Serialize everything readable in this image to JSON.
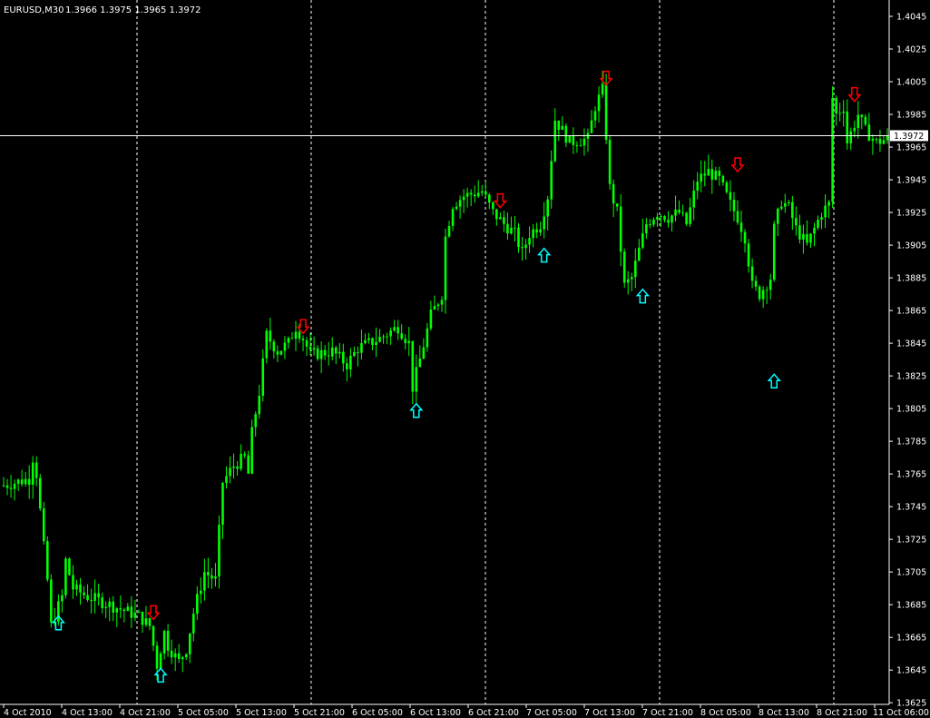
{
  "header": {
    "symbol_text": "EURUSD,M30",
    "ohlc_text": "1.3966 1.3975 1.3965 1.3972"
  },
  "colors": {
    "background": "#000000",
    "candles": "#00FF00",
    "axis": "#FFFFFF",
    "grid": "#FFFFFF",
    "up_arrow": "#00FFFF",
    "down_arrow": "#FF0000",
    "price_line": "#FFFFFF"
  },
  "chart_data": {
    "type": "candlestick",
    "title": "EURUSD,M30",
    "grid": "vertical dashed at day boundaries",
    "ylim": [
      1.3624,
      1.4055
    ],
    "y_ticks": [
      "1.4045",
      "1.4025",
      "1.4005",
      "1.3985",
      "1.3965",
      "1.3945",
      "1.3925",
      "1.3905",
      "1.3885",
      "1.3865",
      "1.3845",
      "1.3825",
      "1.3805",
      "1.3785",
      "1.3765",
      "1.3745",
      "1.3725",
      "1.3705",
      "1.3685",
      "1.3665",
      "1.3645",
      "1.3625"
    ],
    "x_ticks": [
      "4 Oct 2010",
      "4 Oct 13:00",
      "4 Oct 21:00",
      "5 Oct 05:00",
      "5 Oct 13:00",
      "5 Oct 21:00",
      "6 Oct 05:00",
      "6 Oct 13:00",
      "6 Oct 21:00",
      "7 Oct 05:00",
      "7 Oct 13:00",
      "7 Oct 21:00",
      "8 Oct 05:00",
      "8 Oct 13:00",
      "8 Oct 21:00",
      "11 Oct 06:00"
    ],
    "day_separators": [
      "4 Oct 21:00",
      "5 Oct 21:00",
      "6 Oct 21:00",
      "7 Oct 21:00",
      "8 Oct 21:00"
    ],
    "current_price": "1.3972",
    "price_anchors": [
      [
        0,
        1.3758
      ],
      [
        7,
        1.3762
      ],
      [
        8,
        1.3775
      ],
      [
        9,
        1.3765
      ],
      [
        11,
        1.372
      ],
      [
        12,
        1.37
      ],
      [
        13,
        1.3672
      ],
      [
        16,
        1.369
      ],
      [
        17,
        1.3712
      ],
      [
        19,
        1.3695
      ],
      [
        23,
        1.369
      ],
      [
        29,
        1.3685
      ],
      [
        37,
        1.3678
      ],
      [
        40,
        1.3672
      ],
      [
        42,
        1.3648
      ],
      [
        44,
        1.3668
      ],
      [
        45,
        1.366
      ],
      [
        48,
        1.365
      ],
      [
        50,
        1.3658
      ],
      [
        52,
        1.368
      ],
      [
        55,
        1.3705
      ],
      [
        58,
        1.37
      ],
      [
        60,
        1.376
      ],
      [
        63,
        1.377
      ],
      [
        66,
        1.3775
      ],
      [
        67,
        1.3765
      ],
      [
        68,
        1.379
      ],
      [
        70,
        1.3815
      ],
      [
        72,
        1.385
      ],
      [
        75,
        1.384
      ],
      [
        78,
        1.3845
      ],
      [
        80,
        1.3855
      ],
      [
        82,
        1.3848
      ],
      [
        84,
        1.3838
      ],
      [
        90,
        1.384
      ],
      [
        94,
        1.3832
      ],
      [
        97,
        1.3842
      ],
      [
        103,
        1.3848
      ],
      [
        108,
        1.3855
      ],
      [
        111,
        1.3845
      ],
      [
        112,
        1.3818
      ],
      [
        114,
        1.3835
      ],
      [
        117,
        1.3862
      ],
      [
        120,
        1.3875
      ],
      [
        121,
        1.391
      ],
      [
        123,
        1.393
      ],
      [
        126,
        1.3935
      ],
      [
        131,
        1.3938
      ],
      [
        134,
        1.3925
      ],
      [
        137,
        1.3918
      ],
      [
        140,
        1.3912
      ],
      [
        142,
        1.39
      ],
      [
        144,
        1.3912
      ],
      [
        147,
        1.3918
      ],
      [
        149,
        1.3935
      ],
      [
        151,
        1.3982
      ],
      [
        155,
        1.3968
      ],
      [
        160,
        1.397
      ],
      [
        162,
        1.399
      ],
      [
        164,
        1.4
      ],
      [
        165,
        1.3972
      ],
      [
        166,
        1.394
      ],
      [
        168,
        1.3925
      ],
      [
        170,
        1.388
      ],
      [
        172,
        1.3885
      ],
      [
        174,
        1.3902
      ],
      [
        176,
        1.3918
      ],
      [
        179,
        1.3925
      ],
      [
        182,
        1.3922
      ],
      [
        185,
        1.3925
      ],
      [
        187,
        1.3918
      ],
      [
        190,
        1.3945
      ],
      [
        193,
        1.395
      ],
      [
        196,
        1.3945
      ],
      [
        199,
        1.393
      ],
      [
        201,
        1.3922
      ],
      [
        203,
        1.391
      ],
      [
        205,
        1.388
      ],
      [
        207,
        1.3875
      ],
      [
        210,
        1.3885
      ],
      [
        211,
        1.3915
      ],
      [
        213,
        1.3932
      ],
      [
        215,
        1.3928
      ],
      [
        217,
        1.3915
      ],
      [
        220,
        1.3905
      ],
      [
        224,
        1.3925
      ],
      [
        226,
        1.393
      ],
      [
        227,
        1.3995
      ],
      [
        228,
        1.3985
      ],
      [
        230,
        1.399
      ],
      [
        231,
        1.3968
      ],
      [
        234,
        1.3985
      ],
      [
        236,
        1.3975
      ],
      [
        239,
        1.3968
      ],
      [
        242,
        1.397
      ]
    ],
    "signals": [
      {
        "type": "buy",
        "bar": 15,
        "price": 1.3678
      },
      {
        "type": "sell",
        "bar": 41,
        "price": 1.3676
      },
      {
        "type": "buy",
        "bar": 43,
        "price": 1.3646
      },
      {
        "type": "sell",
        "bar": 82,
        "price": 1.3851
      },
      {
        "type": "buy",
        "bar": 113,
        "price": 1.3808
      },
      {
        "type": "sell",
        "bar": 136,
        "price": 1.3928
      },
      {
        "type": "buy",
        "bar": 148,
        "price": 1.3903
      },
      {
        "type": "sell",
        "bar": 165,
        "price": 1.4003
      },
      {
        "type": "buy",
        "bar": 175,
        "price": 1.3878
      },
      {
        "type": "sell",
        "bar": 201,
        "price": 1.395
      },
      {
        "type": "buy",
        "bar": 211,
        "price": 1.3826
      },
      {
        "type": "sell",
        "bar": 233,
        "price": 1.3993
      }
    ]
  }
}
